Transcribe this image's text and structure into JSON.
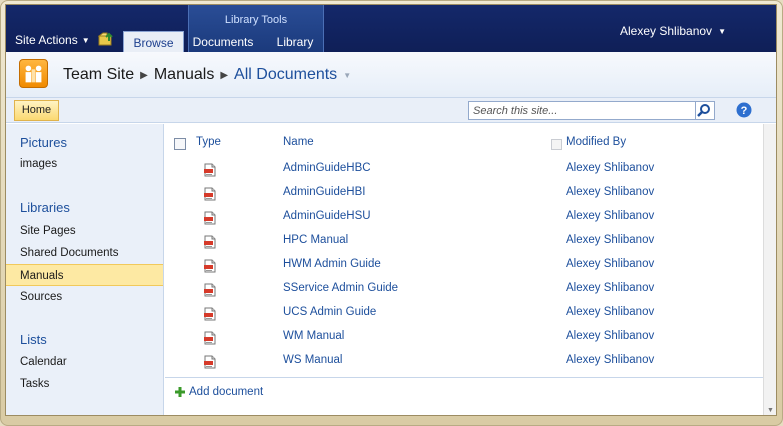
{
  "topbar": {
    "site_actions": "Site Actions",
    "library_tools_label": "Library Tools",
    "tabs": [
      {
        "label": "Browse",
        "active": true
      },
      {
        "label": "Documents",
        "active": false
      },
      {
        "label": "Library",
        "active": false
      }
    ],
    "user_name": "Alexey Shlibanov"
  },
  "breadcrumb": {
    "site": "Team Site",
    "list": "Manuals",
    "view": "All Documents"
  },
  "searchbar": {
    "home_label": "Home",
    "search_placeholder": "Search this site..."
  },
  "leftnav": {
    "sections": [
      {
        "heading": "Pictures",
        "items": [
          "images"
        ]
      },
      {
        "heading": "Libraries",
        "items": [
          "Site Pages",
          "Shared Documents",
          "Manuals",
          "Sources"
        ]
      },
      {
        "heading": "Lists",
        "items": [
          "Calendar",
          "Tasks"
        ]
      }
    ],
    "selected": "Manuals"
  },
  "list": {
    "columns": {
      "type": "Type",
      "name": "Name",
      "modified_by": "Modified By"
    },
    "rows": [
      {
        "name": "AdminGuideHBC",
        "modified_by": "Alexey Shlibanov"
      },
      {
        "name": "AdminGuideHBI",
        "modified_by": "Alexey Shlibanov"
      },
      {
        "name": "AdminGuideHSU",
        "modified_by": "Alexey Shlibanov"
      },
      {
        "name": "HPC Manual",
        "modified_by": "Alexey Shlibanov"
      },
      {
        "name": "HWM Admin Guide",
        "modified_by": "Alexey Shlibanov"
      },
      {
        "name": "SService Admin Guide",
        "modified_by": "Alexey Shlibanov"
      },
      {
        "name": "UCS Admin Guide",
        "modified_by": "Alexey Shlibanov"
      },
      {
        "name": "WM Manual",
        "modified_by": "Alexey Shlibanov"
      },
      {
        "name": "WS Manual",
        "modified_by": "Alexey Shlibanov"
      }
    ],
    "add_document": "Add document",
    "row_icon": "pdf-document-icon"
  },
  "colors": {
    "ribbon": "#14286a",
    "link": "#1d4f9c",
    "selected_nav": "#fde9a3",
    "logo": "#f08a00"
  }
}
